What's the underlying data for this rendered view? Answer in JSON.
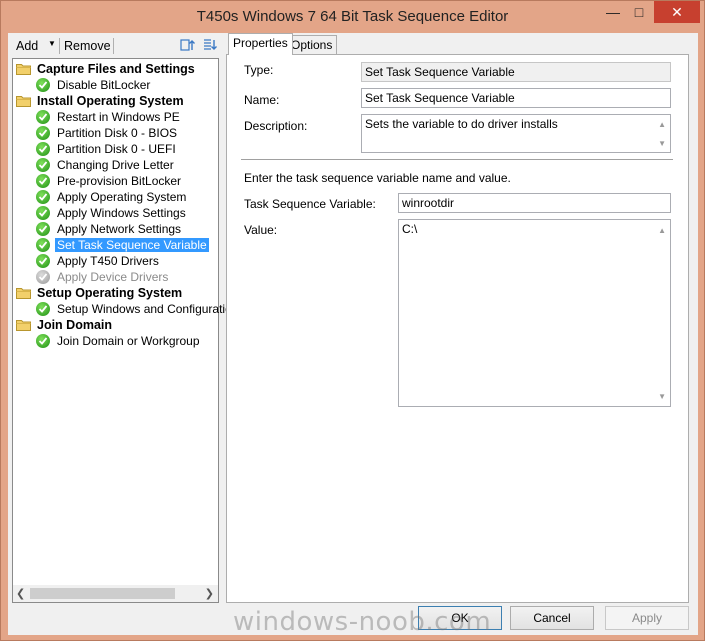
{
  "window": {
    "title": "T450s Windows 7 64 Bit Task Sequence Editor",
    "minimize_glyph": "—",
    "maximize_glyph": "□",
    "close_glyph": "✕"
  },
  "toolbar": {
    "add_label": "Add",
    "add_arrow": "▼",
    "remove_label": "Remove"
  },
  "tree": {
    "items": [
      {
        "label": "Capture Files and Settings",
        "type": "group"
      },
      {
        "label": "Disable BitLocker",
        "type": "step"
      },
      {
        "label": "Install Operating System",
        "type": "group"
      },
      {
        "label": "Restart in Windows PE",
        "type": "step"
      },
      {
        "label": "Partition Disk 0 - BIOS",
        "type": "step"
      },
      {
        "label": "Partition Disk 0 - UEFI",
        "type": "step"
      },
      {
        "label": "Changing Drive Letter",
        "type": "step"
      },
      {
        "label": "Pre-provision BitLocker",
        "type": "step"
      },
      {
        "label": "Apply Operating System",
        "type": "step"
      },
      {
        "label": "Apply Windows Settings",
        "type": "step"
      },
      {
        "label": "Apply Network Settings",
        "type": "step"
      },
      {
        "label": "Set Task Sequence Variable",
        "type": "step",
        "selected": true
      },
      {
        "label": "Apply T450 Drivers",
        "type": "step"
      },
      {
        "label": "Apply Device Drivers",
        "type": "step",
        "disabled": true
      },
      {
        "label": "Setup Operating System",
        "type": "group"
      },
      {
        "label": "Setup Windows and Configuration",
        "type": "step"
      },
      {
        "label": "Join Domain",
        "type": "group"
      },
      {
        "label": "Join Domain or Workgroup",
        "type": "step"
      }
    ],
    "scroll_left": "❮",
    "scroll_right": "❯"
  },
  "tabs": [
    {
      "label": "Properties",
      "active": true
    },
    {
      "label": "Options",
      "active": false
    }
  ],
  "properties": {
    "type_label": "Type:",
    "type_value": "Set Task Sequence Variable",
    "name_label": "Name:",
    "name_value": "Set Task Sequence Variable",
    "description_label": "Description:",
    "description_value": "Sets the variable to do driver installs",
    "instructions": "Enter the task sequence variable name and value.",
    "variable_label": "Task Sequence Variable:",
    "variable_value": "winrootdir",
    "value_label": "Value:",
    "value_value": "C:\\",
    "scroll_up": "▲",
    "scroll_down": "▼"
  },
  "buttons": {
    "ok": "OK",
    "cancel": "Cancel",
    "apply": "Apply"
  },
  "watermark": "windows-noob.com",
  "colors": {
    "titlebar": "#e3a588",
    "selection": "#3399ff",
    "close": "#c7402f"
  }
}
